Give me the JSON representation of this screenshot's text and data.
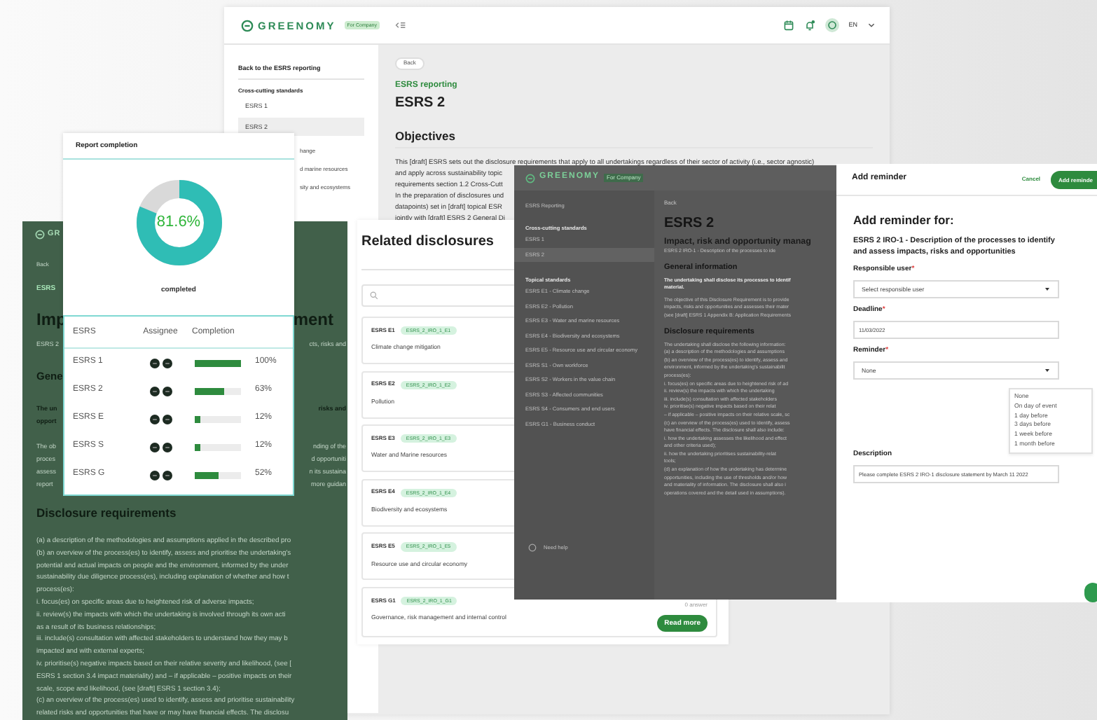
{
  "back_window": {
    "logo": "GREENOMY",
    "badge": "For Company",
    "language": "EN",
    "sidebar": {
      "back_link": "Back to the ESRS reporting",
      "section": "Cross-cutting standards",
      "items": [
        {
          "label": "ESRS 1",
          "selected": false
        },
        {
          "label": "ESRS 2",
          "selected": true
        }
      ],
      "cut_items": [
        "hange",
        "d marine resources",
        "sity and ecosystems"
      ]
    },
    "content": {
      "back": "Back",
      "breadcrumb": "ESRS reporting",
      "title": "ESRS 2",
      "section": "Objectives",
      "lines": [
        "This [draft] ESRS sets out the disclosure requirements that apply to all undertakings regardless of their sector of activity (i.e., sector agnostic)",
        "and apply across sustainability topic",
        "requirements section 1.2 Cross-Cutt",
        "In the preparation of disclosures und",
        "datapoints) set in [draft] topical ESR",
        "jointly with [draft] ESRS 2 General Di"
      ]
    }
  },
  "green_window": {
    "logo": "GR",
    "back": "Back",
    "breadcrumb": "ESRS",
    "heading": {
      "left": "Imp",
      "right": "ment"
    },
    "subtitle": {
      "left": "ESRS 2",
      "right": "cts, risks and"
    },
    "section": "Gene",
    "bold_rows": [
      {
        "left": "The un",
        "right": "risks and"
      },
      {
        "left": "opport"
      }
    ],
    "para_rows": [
      {
        "left": "The ob",
        "right": "nding of the"
      },
      {
        "left": "proces",
        "right": "d opportuniti"
      },
      {
        "left": "assess",
        "right": "n its sustaina"
      },
      {
        "left": "report",
        "right": "more guidan"
      }
    ],
    "disclosure_title": "Disclosure requirements",
    "lines": [
      "(a) a description of the methodologies and assumptions applied in the described pro",
      "(b) an overview of the process(es) to identify, assess and prioritise the undertaking's",
      "potential and actual impacts on people and the environment, informed by the under",
      "sustainability due diligence process(es), including explanation of whether and how t",
      "process(es):",
      "i. focus(es) on specific areas due to heightened risk of adverse impacts;",
      "ii. review(s) the impacts with which the undertaking is involved through its own acti",
      "as a result of its business relationships;",
      "iii. include(s) consultation with affected stakeholders to understand how they may b",
      "impacted and with external experts;",
      "iv. prioritise(s) negative impacts based on their relative severity and likelihood, (see [",
      "ESRS 1 section 3.4 impact materiality) and – if applicable – positive impacts on their",
      "scale, scope and likelihood, (see [draft] ESRS 1 section 3.4);",
      "(c) an overview of the process(es) used to identify, assess and prioritise sustainability",
      "related risks and opportunities that have or may have financial effects. The disclosu"
    ]
  },
  "report_completion": {
    "title": "Report completion",
    "percent": "81.6%",
    "level": 0.816,
    "caption": "completed",
    "columns": [
      "ESRS",
      "Assignee",
      "Completion"
    ],
    "rows": [
      {
        "esrs": "ESRS 1",
        "level": 1.0,
        "completion": "100%"
      },
      {
        "esrs": "ESRS 2",
        "level": 0.63,
        "completion": "63%"
      },
      {
        "esrs": "ESRS E",
        "level": 0.12,
        "completion": "12%"
      },
      {
        "esrs": "ESRS S",
        "level": 0.12,
        "completion": "12%"
      },
      {
        "esrs": "ESRS G",
        "level": 0.52,
        "completion": "52%"
      }
    ]
  },
  "related_disclosures": {
    "title": "Related disclosures",
    "items": [
      {
        "code": "ESRS E1",
        "tag": "ESRS_2_IRO_1_E1",
        "name": "Climate change mitigation"
      },
      {
        "code": "ESRS E2",
        "tag": "ESRS_2_IRO_1_E2",
        "name": "Pollution"
      },
      {
        "code": "ESRS E3",
        "tag": "ESRS_2_IRO_1_E3",
        "name": "Water and Marine resources"
      },
      {
        "code": "ESRS E4",
        "tag": "ESRS_2_IRO_1_E4",
        "name": "Biodiversity and ecosystems"
      },
      {
        "code": "ESRS E5",
        "tag": "ESRS_2_IRO_1_E5",
        "name": "Resource use and circular economy"
      },
      {
        "code": "ESRS G1",
        "tag": "ESRS_2_IRO_1_G1",
        "name": "Governance, risk management and internal control",
        "answers": "0 answer",
        "action": "Read more"
      }
    ]
  },
  "overlay_window": {
    "logo": "GREENOMY",
    "badge": "For Company",
    "sidebar": {
      "back_link": "ESRS Reporting",
      "section": "Cross-cutting standards",
      "items": [
        {
          "label": "ESRS 1",
          "selected": false
        },
        {
          "label": "ESRS 2",
          "selected": true
        }
      ],
      "topical_section": "Topical standards",
      "topical_items": [
        "ESRS E1 - Climate change",
        "ESRS E2 - Pollution",
        "ESRS E3 - Water and marine resources",
        "ESRS E4 - Biodiversity and ecosystems",
        "ESRS E5 - Resource use and circular economy",
        "ESRS S1 - Own workforce",
        "ESRS S2 - Workers in the value chain",
        "ESRS S3 - Affected communities",
        "ESRS S4 - Consumers and end users",
        "ESRS G1 - Business conduct"
      ],
      "help": "Need help"
    },
    "content": {
      "back": "Back",
      "title": "ESRS 2",
      "subtitle": "Impact, risk and opportunity manag",
      "code": "ESRS 2 IRO-1 - Description of the processes to ide",
      "general": "General information",
      "bold_lines": [
        "The undertaking shall disclose its processes to identif",
        "material."
      ],
      "para_lines": [
        "The objective of this Disclosure Requirement is to provide",
        "impacts, risks and opportunities and assesses their mater",
        "(see [draft] ESRS 1 Appendix B: Application Requirements"
      ],
      "disclosure_title": "Disclosure requirements",
      "lines": [
        "The undertaking shall disclose the following information:",
        "(a) a description of the methodologies and assumptions",
        "(b) an overview of the process(es) to identify, assess and",
        "environment, informed by the undertaking's sustainabilit",
        "process(es):",
        "i. focus(es) on specific areas due to heightened risk of ad",
        "ii. review(s) the impacts with which the undertaking",
        "iii. include(s) consultation with affected stakeholders",
        "iv. prioritise(s) negative impacts based on their relat",
        "– if applicable – positive impacts on their relative scale, sc",
        "(c) an overview of the process(es) used to identify, assess",
        "have financial effects. The disclosure shall also include:",
        "i. how the undertaking assesses the likelihood and effect",
        "and other criteria used);",
        "ii. how the undertaking prioritises sustainability-relat",
        "tools;",
        "(d) an explanation of how the undertaking has determine",
        "opportunities, including the use of thresholds and/or how",
        "and materiality of information. The disclosure shall also i",
        "operations covered and the detail used in assumptions)."
      ]
    }
  },
  "add_reminder": {
    "title": "Add reminder",
    "required_mark": "*",
    "cancel": "Cancel",
    "submit": "Add reminde",
    "heading": "Add reminder for:",
    "subject": "ESRS 2 IRO-1 - Description of the processes to identify and assess impacts, risks and opportunities",
    "fields": [
      {
        "label": "Responsible user",
        "required": true,
        "kind": "select",
        "placeholder": "Select responsible user"
      },
      {
        "label": "Deadline",
        "required": true,
        "kind": "input",
        "value": "11/03/2022"
      },
      {
        "label": "Reminder",
        "required": true,
        "kind": "select",
        "value": "None",
        "open": true,
        "options": [
          "None",
          "On day of event",
          "1 day before",
          "3 days before",
          "1 week before",
          "1 month before"
        ]
      },
      {
        "label": "Description",
        "required": false,
        "kind": "input",
        "value": "Please complete ESRS 2 IRO-1 disclosure statement by March 11 2022"
      }
    ]
  }
}
